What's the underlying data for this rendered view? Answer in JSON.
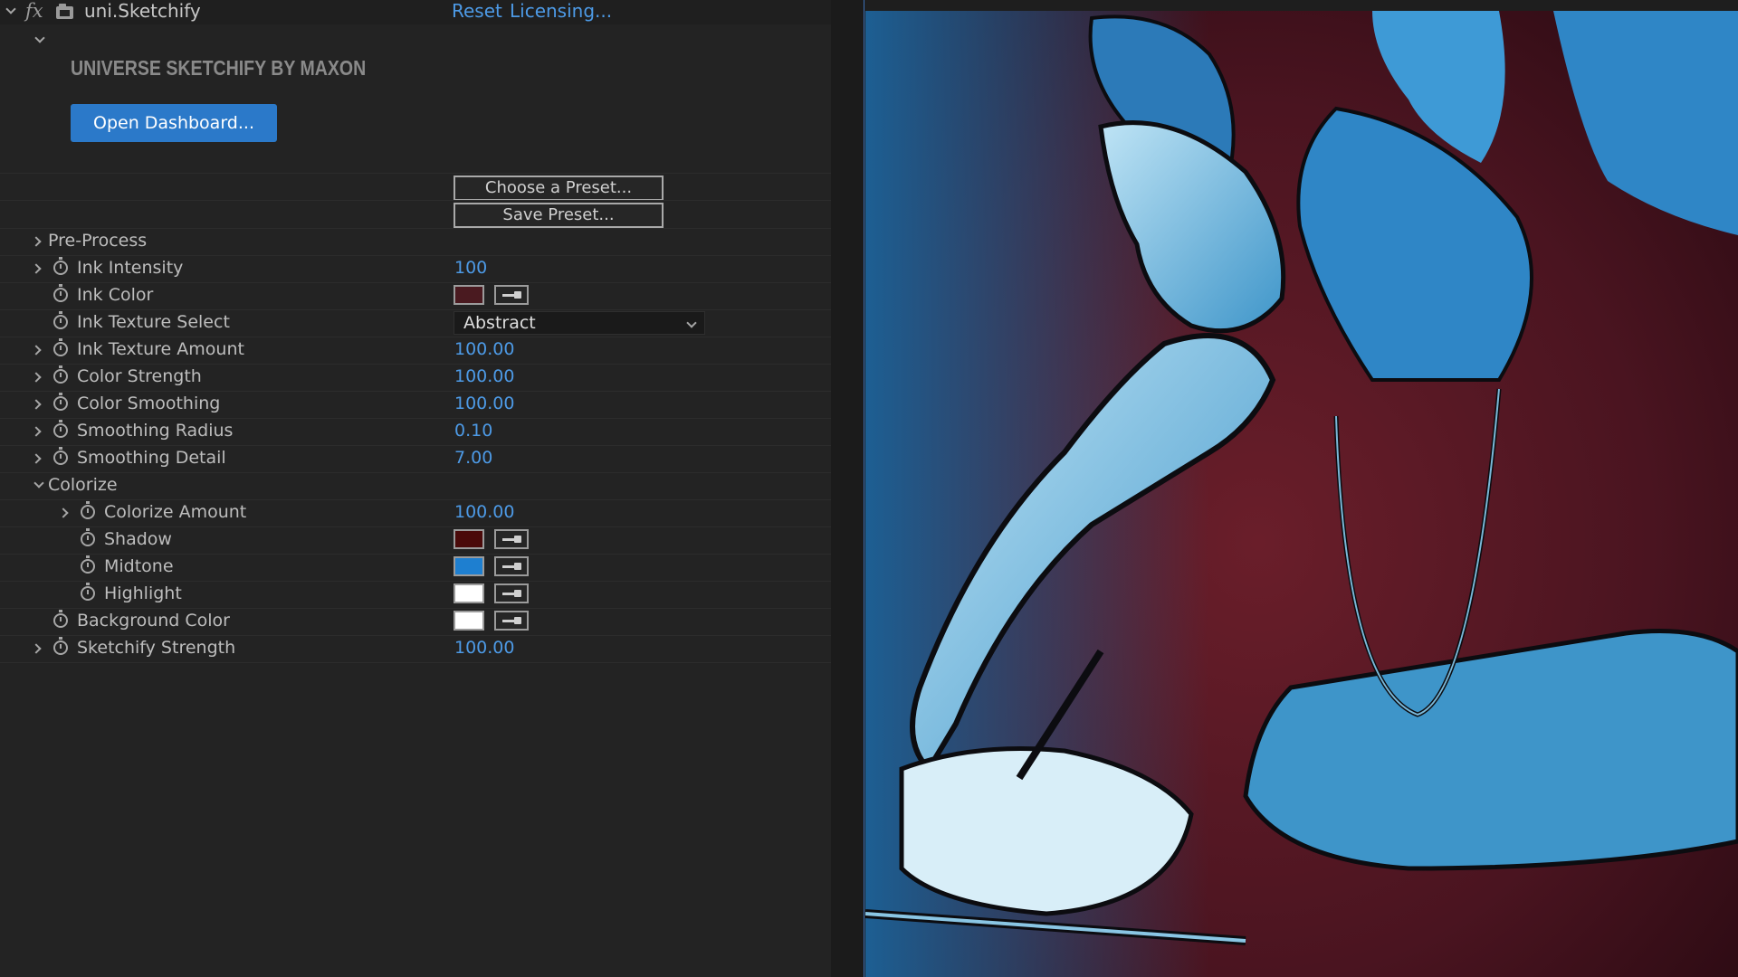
{
  "header": {
    "effect_name": "uni.Sketchify",
    "reset_label": "Reset",
    "licensing_label": "Licensing..."
  },
  "brand": {
    "title": "UNIVERSE SKETCHIFY BY MAXON",
    "dashboard_label": "Open Dashboard..."
  },
  "presets": {
    "choose_label": "Choose a Preset...",
    "save_label": "Save Preset..."
  },
  "properties": {
    "pre_process": {
      "label": "Pre-Process"
    },
    "ink_intensity": {
      "label": "Ink Intensity",
      "value": "100"
    },
    "ink_color": {
      "label": "Ink Color",
      "color": "#4a1a20"
    },
    "ink_texture_select": {
      "label": "Ink Texture Select",
      "value": "Abstract"
    },
    "ink_texture_amount": {
      "label": "Ink Texture Amount",
      "value": "100.00"
    },
    "color_strength": {
      "label": "Color Strength",
      "value": "100.00"
    },
    "color_smoothing": {
      "label": "Color Smoothing",
      "value": "100.00"
    },
    "smoothing_radius": {
      "label": "Smoothing Radius",
      "value": "0.10"
    },
    "smoothing_detail": {
      "label": "Smoothing Detail",
      "value": "7.00"
    },
    "colorize": {
      "label": "Colorize"
    },
    "colorize_amount": {
      "label": "Colorize Amount",
      "value": "100.00"
    },
    "shadow": {
      "label": "Shadow",
      "color": "#4a0a0a"
    },
    "midtone": {
      "label": "Midtone",
      "color": "#1e7fd0"
    },
    "highlight": {
      "label": "Highlight",
      "color": "#ffffff"
    },
    "background_color": {
      "label": "Background Color",
      "color": "#ffffff"
    },
    "sketchify_strength": {
      "label": "Sketchify Strength",
      "value": "100.00"
    }
  },
  "colors": {
    "accent": "#2b79c9",
    "link": "#4d9ae6",
    "preview_blue": "#2f86c6",
    "preview_red": "#5a1a22"
  }
}
